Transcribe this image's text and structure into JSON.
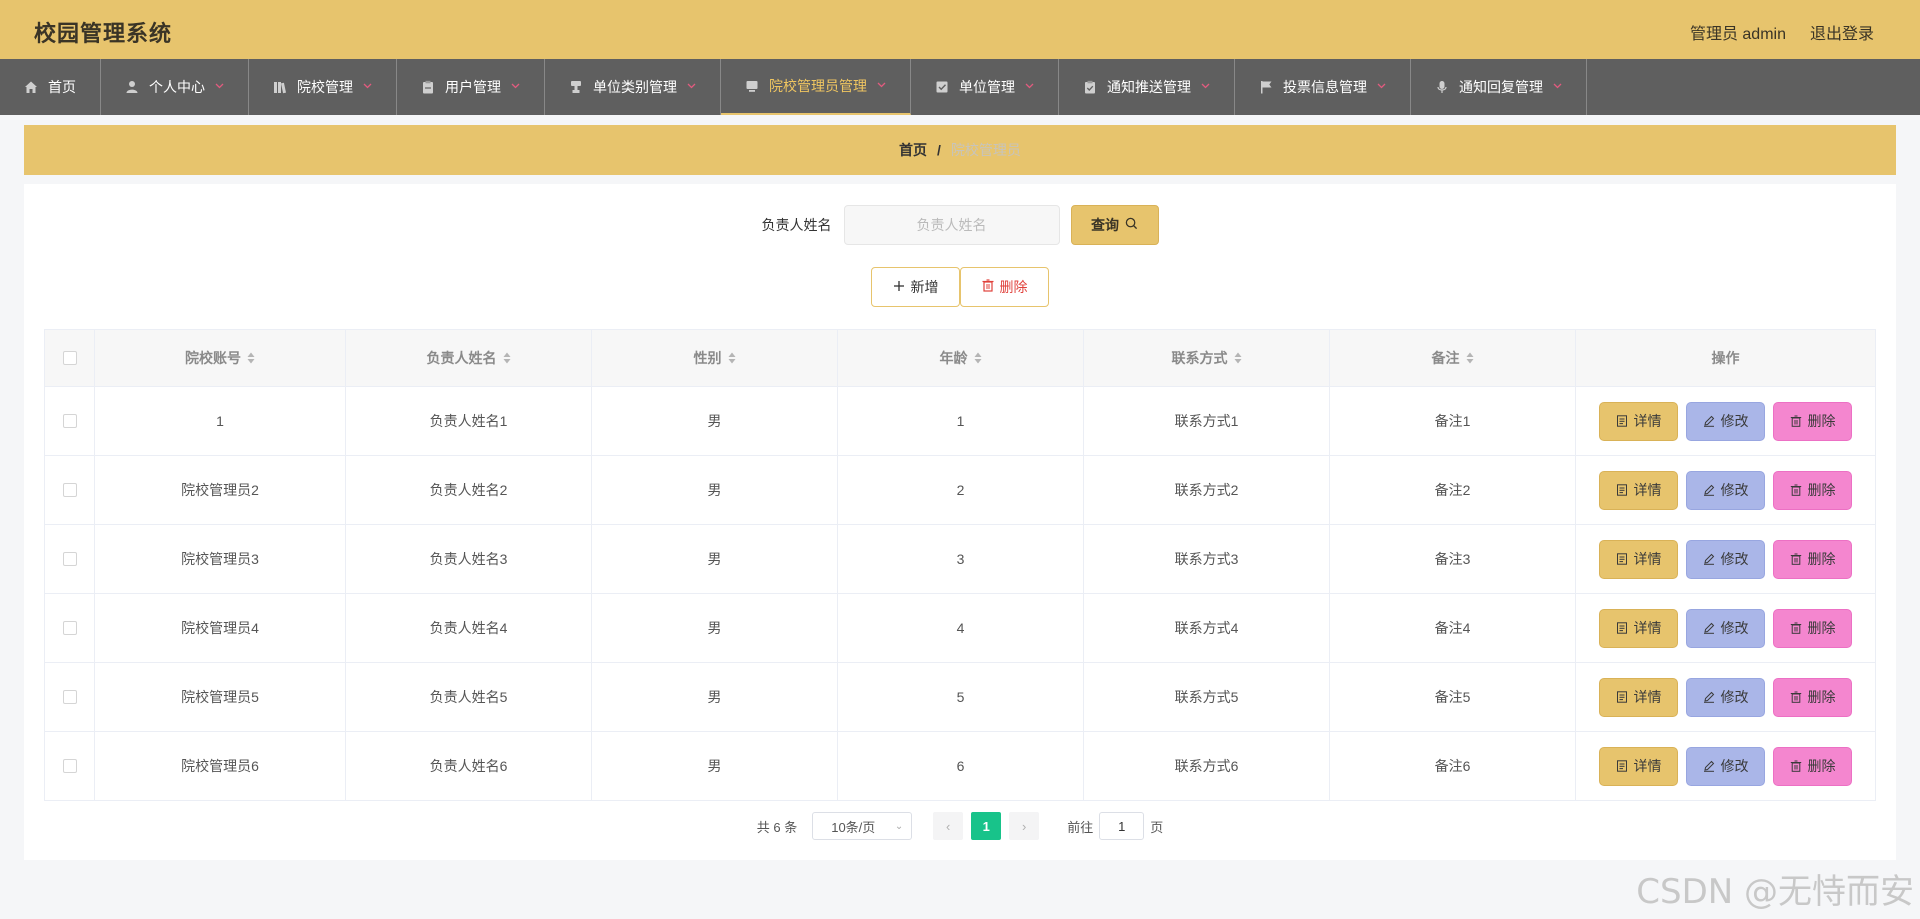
{
  "app": {
    "title": "校园管理系统"
  },
  "header": {
    "user_label": "管理员 admin",
    "logout_label": "退出登录"
  },
  "nav": [
    {
      "label": "首页",
      "icon": "home-icon",
      "has_menu": false,
      "active": false
    },
    {
      "label": "个人中心",
      "icon": "user-icon",
      "has_menu": true,
      "active": false
    },
    {
      "label": "院校管理",
      "icon": "book-icon",
      "has_menu": true,
      "active": false
    },
    {
      "label": "用户管理",
      "icon": "clipboard-icon",
      "has_menu": true,
      "active": false
    },
    {
      "label": "单位类别管理",
      "icon": "stamp-icon",
      "has_menu": true,
      "active": false
    },
    {
      "label": "院校管理员管理",
      "icon": "monitor-icon",
      "has_menu": true,
      "active": true
    },
    {
      "label": "单位管理",
      "icon": "checkbox-icon",
      "has_menu": true,
      "active": false
    },
    {
      "label": "通知推送管理",
      "icon": "clipboard-check-icon",
      "has_menu": true,
      "active": false
    },
    {
      "label": "投票信息管理",
      "icon": "flag-icon",
      "has_menu": true,
      "active": false
    },
    {
      "label": "通知回复管理",
      "icon": "microphone-icon",
      "has_menu": true,
      "active": false
    }
  ],
  "breadcrumb": {
    "home": "首页",
    "separator": "/",
    "current": "院校管理员"
  },
  "search": {
    "label": "负责人姓名",
    "placeholder": "负责人姓名",
    "value": "",
    "button_label": "查询"
  },
  "actions": {
    "add_label": "新增",
    "delete_label": "删除"
  },
  "table": {
    "columns": [
      "院校账号",
      "负责人姓名",
      "性别",
      "年龄",
      "联系方式",
      "备注",
      "操作"
    ],
    "rows": [
      {
        "account": "1",
        "name": "负责人姓名1",
        "gender": "男",
        "age": "1",
        "contact": "联系方式1",
        "remark": "备注1"
      },
      {
        "account": "院校管理员2",
        "name": "负责人姓名2",
        "gender": "男",
        "age": "2",
        "contact": "联系方式2",
        "remark": "备注2"
      },
      {
        "account": "院校管理员3",
        "name": "负责人姓名3",
        "gender": "男",
        "age": "3",
        "contact": "联系方式3",
        "remark": "备注3"
      },
      {
        "account": "院校管理员4",
        "name": "负责人姓名4",
        "gender": "男",
        "age": "4",
        "contact": "联系方式4",
        "remark": "备注4"
      },
      {
        "account": "院校管理员5",
        "name": "负责人姓名5",
        "gender": "男",
        "age": "5",
        "contact": "联系方式5",
        "remark": "备注5"
      },
      {
        "account": "院校管理员6",
        "name": "负责人姓名6",
        "gender": "男",
        "age": "6",
        "contact": "联系方式6",
        "remark": "备注6"
      }
    ],
    "row_actions": {
      "detail": "详情",
      "edit": "修改",
      "delete": "删除"
    }
  },
  "pagination": {
    "total_text": "共 6 条",
    "page_size": "10条/页",
    "current_page": "1",
    "goto_prefix": "前往",
    "goto_value": "1",
    "goto_suffix": "页"
  },
  "watermark": "CSDN @无恃而安",
  "colors": {
    "header": "#e7c46d",
    "nav": "#5f5f5f",
    "active_nav_text": "#f0c660",
    "detail_btn": "#e7c46d",
    "edit_btn": "#aab6e8",
    "delete_btn": "#f486cf",
    "page_active": "#18c38a"
  }
}
